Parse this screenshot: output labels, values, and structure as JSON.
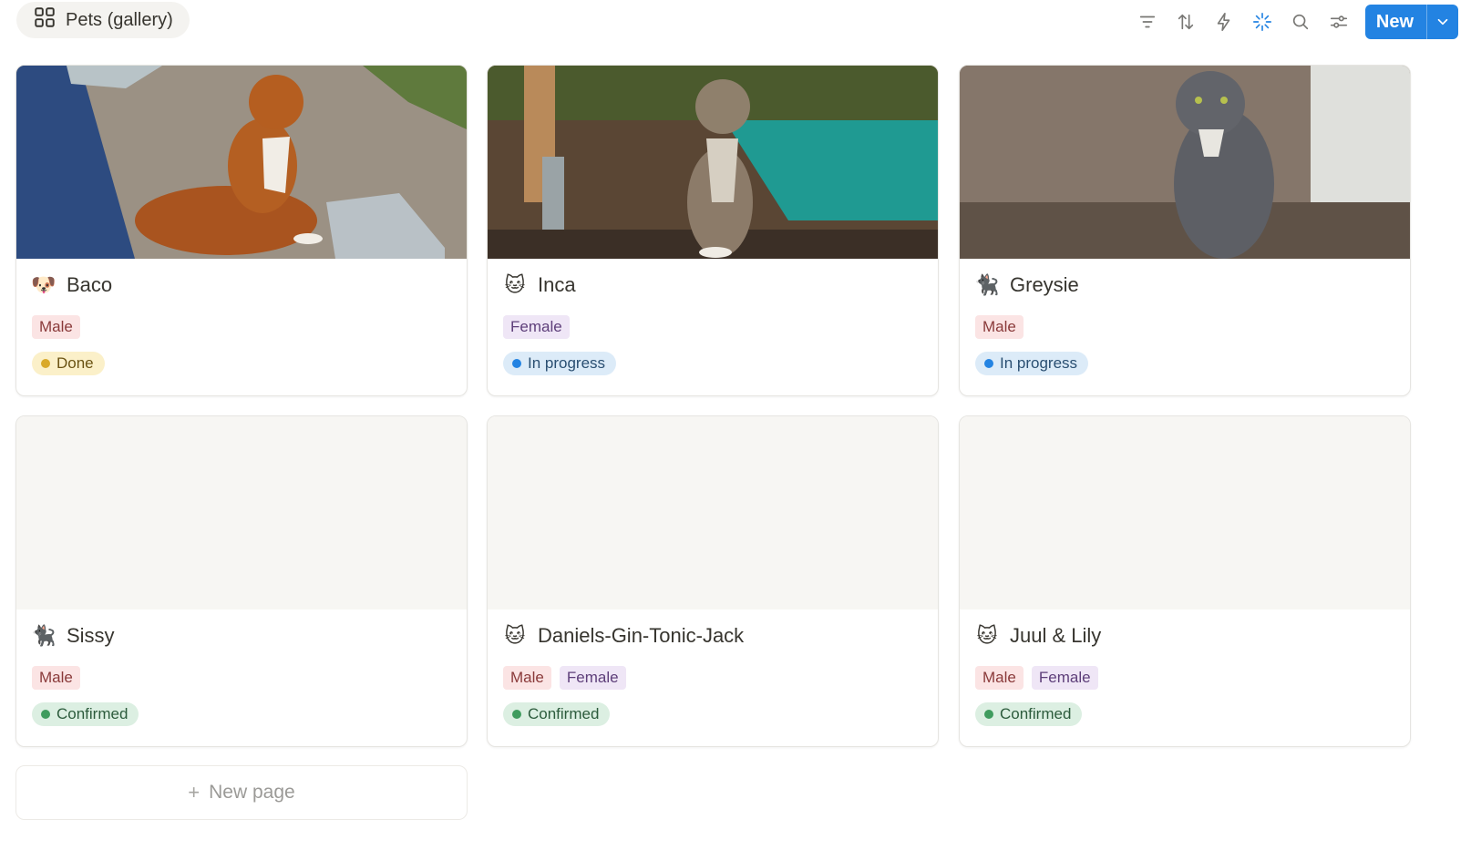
{
  "view": {
    "title": "Pets (gallery)",
    "icon": "gallery-grid-icon"
  },
  "toolbar": {
    "icons": [
      "filter-icon",
      "sort-icon",
      "automation-icon",
      "ai-sparkle-icon",
      "search-icon",
      "settings-sliders-icon"
    ],
    "new_label": "New",
    "accent": "#2383e2"
  },
  "cards": [
    {
      "name": "Baco",
      "emoji": "🐶",
      "cover": "dog-photo",
      "tags": [
        "Male"
      ],
      "status": "Done"
    },
    {
      "name": "Inca",
      "emoji": "🐱",
      "cover": "cat-photo",
      "tags": [
        "Female"
      ],
      "status": "In progress"
    },
    {
      "name": "Greysie",
      "emoji": "🐈‍⬛",
      "cover": "grey-cat-photo",
      "tags": [
        "Male"
      ],
      "status": "In progress"
    },
    {
      "name": "Sissy",
      "emoji": "🐈‍⬛",
      "cover": "",
      "tags": [
        "Male"
      ],
      "status": "Confirmed"
    },
    {
      "name": "Daniels-Gin-Tonic-Jack",
      "emoji": "🐱",
      "cover": "",
      "tags": [
        "Male",
        "Female"
      ],
      "status": "Confirmed"
    },
    {
      "name": "Juul & Lily",
      "emoji": "🐱",
      "cover": "",
      "tags": [
        "Male",
        "Female"
      ],
      "status": "Confirmed"
    }
  ],
  "new_page_label": "New page",
  "status_colors": {
    "Done": "#d9a92a",
    "In progress": "#2383e2",
    "Confirmed": "#3f9c5e"
  }
}
